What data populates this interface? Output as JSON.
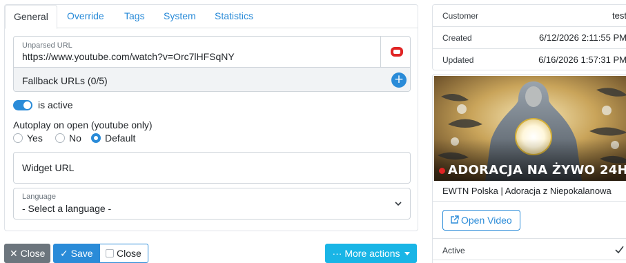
{
  "tabs": [
    {
      "label": "General",
      "active": true
    },
    {
      "label": "Override",
      "active": false
    },
    {
      "label": "Tags",
      "active": false
    },
    {
      "label": "System",
      "active": false
    },
    {
      "label": "Statistics",
      "active": false
    }
  ],
  "url": {
    "label": "Unparsed URL",
    "value": "https://www.youtube.com/watch?v=Orc7lHFSqNY",
    "provider_icon": "youtube-icon"
  },
  "fallback": {
    "label": "Fallback URLs (0/5)",
    "add_symbol": "+"
  },
  "active_toggle": {
    "label": "is active",
    "on": true
  },
  "autoplay": {
    "label": "Autoplay on open (youtube only)",
    "options": [
      "Yes",
      "No",
      "Default"
    ],
    "selected": "Default"
  },
  "widget_url": {
    "label": "Widget URL"
  },
  "language": {
    "label": "Language",
    "value": "- Select a language -"
  },
  "buttons": {
    "close": "Close",
    "save": "Save",
    "close_checkbox": "Close",
    "more_actions": "More actions"
  },
  "info": {
    "rows": [
      {
        "key": "Customer",
        "value": "test"
      },
      {
        "key": "Created",
        "value": "6/12/2026 2:11:55 PM"
      },
      {
        "key": "Updated",
        "value": "6/16/2026 1:57:31 PM"
      }
    ]
  },
  "video": {
    "thumbnail_caption": "ADORACJA NA ŻYWO 24H",
    "title": "EWTN Polska | Adoracja z Niepokalanowa",
    "open_label": "Open Video",
    "active_label": "Active",
    "active": true
  },
  "colors": {
    "accent": "#2a8bd8",
    "secondary": "#6c757d",
    "info": "#19b5e6",
    "youtube": "#e02424"
  }
}
